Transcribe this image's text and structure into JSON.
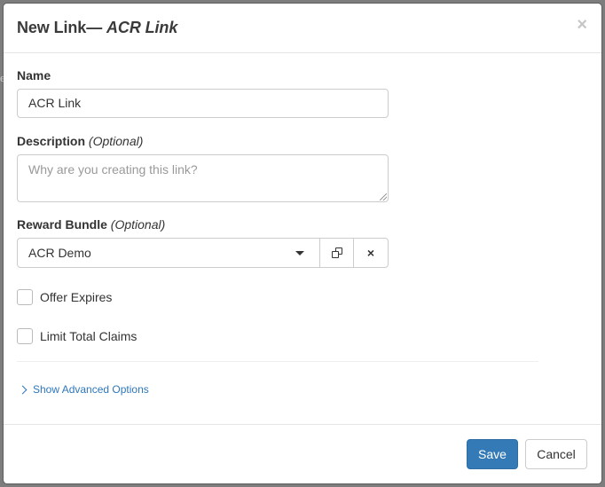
{
  "backdrop": {
    "edge_char": "e"
  },
  "modal": {
    "title_prefix": "New Link",
    "title_dash": "—",
    "title_name": "ACR Link",
    "close_glyph": "×"
  },
  "form": {
    "name_label": "Name",
    "name_value": "ACR Link",
    "description_label": "Description",
    "description_optional": "(Optional)",
    "description_placeholder": "Why are you creating this link?",
    "reward_label": "Reward Bundle",
    "reward_optional": "(Optional)",
    "reward_value": "ACR Demo",
    "clear_glyph": "×",
    "offer_expires_label": "Offer Expires",
    "offer_expires_checked": false,
    "limit_claims_label": "Limit Total Claims",
    "limit_claims_checked": false,
    "advanced_link": "Show Advanced Options"
  },
  "footer": {
    "save_label": "Save",
    "cancel_label": "Cancel"
  },
  "colors": {
    "primary": "#337ab7",
    "link": "#2e77bb",
    "backdrop": "#7d7d7d"
  },
  "icons": [
    "close-icon",
    "caret-down-icon",
    "copy-icon",
    "clear-icon",
    "chevron-right-icon"
  ]
}
